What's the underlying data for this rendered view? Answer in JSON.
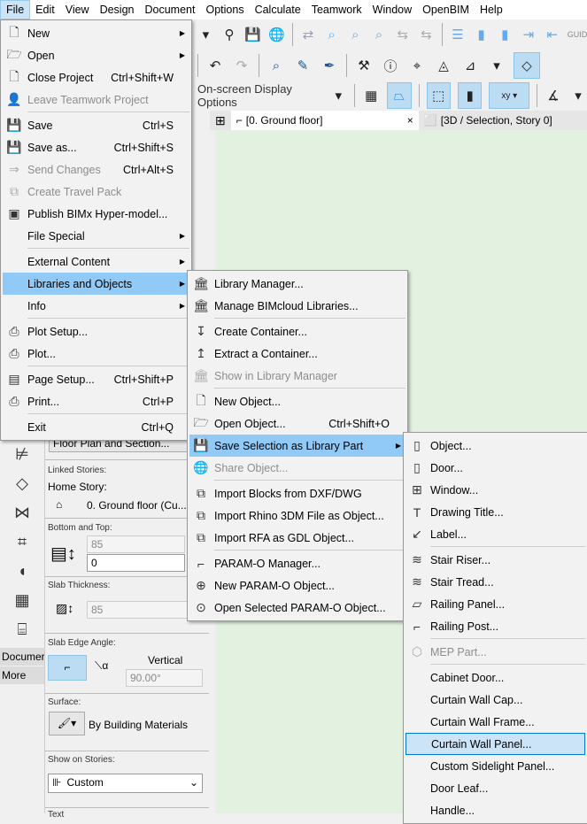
{
  "menubar": [
    "File",
    "Edit",
    "View",
    "Design",
    "Document",
    "Options",
    "Calculate",
    "Teamwork",
    "Window",
    "OpenBIM",
    "Help"
  ],
  "toolbar": {
    "display_options": "On-screen Display Options"
  },
  "tabs": {
    "floor": "[0. Ground floor]",
    "close": "×",
    "view3d": "[3D / Selection, Story 0]"
  },
  "toolbox": {
    "document": "Documer",
    "more": "More"
  },
  "infobox": {
    "floor_plan": "Floor Plan and Section...",
    "linked_stories": "Linked Stories:",
    "home_story": "Home Story:",
    "home_story_value": "0. Ground floor (Cu...",
    "bottom_top": "Bottom and Top:",
    "top_value": "85",
    "bottom_value": "0",
    "slab_thickness": "Slab Thickness:",
    "thickness_value": "85",
    "edge_angle": "Slab Edge Angle:",
    "vertical": "Vertical",
    "angle_value": "90.00°",
    "surface": "Surface:",
    "surface_value": "By Building Materials",
    "show_on_stories": "Show on Stories:",
    "stories_value": "Custom",
    "text": "Text"
  },
  "file_menu": [
    {
      "label": "New",
      "icon": "🗋",
      "submenu": true
    },
    {
      "label": "Open",
      "icon": "🗁",
      "submenu": true
    },
    {
      "label": "Close Project",
      "shortcut": "Ctrl+Shift+W",
      "icon": "🗋"
    },
    {
      "label": "Leave Teamwork Project",
      "icon": "👤",
      "disabled": true
    },
    {
      "sep": true
    },
    {
      "label": "Save",
      "shortcut": "Ctrl+S",
      "icon": "💾"
    },
    {
      "label": "Save as...",
      "shortcut": "Ctrl+Shift+S",
      "icon": "💾"
    },
    {
      "label": "Send Changes",
      "shortcut": "Ctrl+Alt+S",
      "icon": "⇒",
      "disabled": true
    },
    {
      "label": "Create Travel Pack",
      "icon": "⧉",
      "disabled": true
    },
    {
      "label": "Publish BIMx Hyper-model...",
      "icon": "▣"
    },
    {
      "label": "File Special",
      "submenu": true
    },
    {
      "sep": true
    },
    {
      "label": "External Content",
      "submenu": true
    },
    {
      "label": "Libraries and Objects",
      "submenu": true,
      "highlight": true
    },
    {
      "label": "Info",
      "submenu": true
    },
    {
      "sep": true
    },
    {
      "label": "Plot Setup...",
      "icon": "⎙"
    },
    {
      "label": "Plot...",
      "icon": "⎙"
    },
    {
      "sep": true
    },
    {
      "label": "Page Setup...",
      "shortcut": "Ctrl+Shift+P",
      "icon": "▤"
    },
    {
      "label": "Print...",
      "shortcut": "Ctrl+P",
      "icon": "⎙"
    },
    {
      "sep": true
    },
    {
      "label": "Exit",
      "shortcut": "Ctrl+Q"
    }
  ],
  "libraries_menu": [
    {
      "label": "Library Manager...",
      "icon": "🏛"
    },
    {
      "label": "Manage BIMcloud Libraries...",
      "icon": "🏛"
    },
    {
      "sep": true
    },
    {
      "label": "Create Container...",
      "icon": "↧"
    },
    {
      "label": "Extract a Container...",
      "icon": "↥"
    },
    {
      "label": "Show in Library Manager",
      "icon": "🏛",
      "disabled": true
    },
    {
      "sep": true
    },
    {
      "label": "New Object...",
      "icon": "🗋"
    },
    {
      "label": "Open Object...",
      "shortcut": "Ctrl+Shift+O",
      "icon": "🗁"
    },
    {
      "label": "Save Selection as Library Part",
      "icon": "💾",
      "submenu": true,
      "highlight": true
    },
    {
      "label": "Share Object...",
      "icon": "🌐",
      "disabled": true
    },
    {
      "sep": true
    },
    {
      "label": "Import Blocks from DXF/DWG",
      "icon": "⧉"
    },
    {
      "label": "Import Rhino 3DM File as Object...",
      "icon": "⧉"
    },
    {
      "label": "Import RFA as GDL Object...",
      "icon": "⧉"
    },
    {
      "sep": true
    },
    {
      "label": "PARAM-O Manager...",
      "icon": "⌐"
    },
    {
      "label": "New PARAM-O Object...",
      "icon": "⊕"
    },
    {
      "label": "Open Selected PARAM-O Object...",
      "icon": "⊙"
    }
  ],
  "save_selection_menu": [
    {
      "label": "Object...",
      "icon": "▯"
    },
    {
      "label": "Door...",
      "icon": "▯"
    },
    {
      "label": "Window...",
      "icon": "⊞"
    },
    {
      "label": "Drawing Title...",
      "icon": "T"
    },
    {
      "label": "Label...",
      "icon": "↙"
    },
    {
      "sep": true
    },
    {
      "label": "Stair Riser...",
      "icon": "≋"
    },
    {
      "label": "Stair Tread...",
      "icon": "≋"
    },
    {
      "label": "Railing Panel...",
      "icon": "▱"
    },
    {
      "label": "Railing Post...",
      "icon": "⌐"
    },
    {
      "sep": true
    },
    {
      "label": "MEP Part...",
      "icon": "⬡",
      "disabled": true
    },
    {
      "sep": true
    },
    {
      "label": "Cabinet Door..."
    },
    {
      "label": "Curtain Wall Cap..."
    },
    {
      "label": "Curtain Wall Frame..."
    },
    {
      "label": "Curtain Wall Panel...",
      "highlight2": true
    },
    {
      "label": "Custom Sidelight Panel..."
    },
    {
      "label": "Door Leaf..."
    },
    {
      "label": "Handle..."
    }
  ]
}
